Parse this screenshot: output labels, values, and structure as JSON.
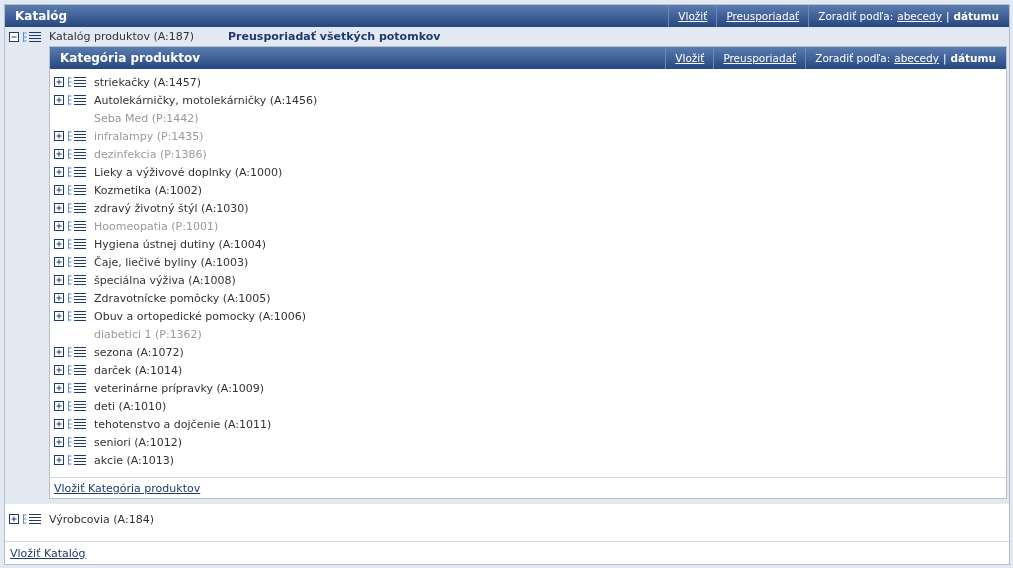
{
  "catalog": {
    "title": "Katalóg",
    "actions": [
      "Vložiť",
      "Preusporiadať"
    ],
    "sort_label": "Zoradiť podľa:",
    "sort_options": [
      {
        "label": "abecedy",
        "selected": false
      },
      {
        "label": "dátumu",
        "selected": true
      }
    ],
    "sort_separator": "|",
    "nodes": [
      {
        "label": "Katalóg produktov (A:187)",
        "expanded": true,
        "action": "Preusporiadať všetkých potomkov",
        "panel": {
          "title": "Kategória produktov",
          "actions": [
            "Vložiť",
            "Preusporiadať"
          ],
          "sort_label": "Zoradiť podľa:",
          "sort_options": [
            {
              "label": "abecedy",
              "selected": false
            },
            {
              "label": "dátumu",
              "selected": true
            }
          ],
          "sort_separator": "|",
          "children": [
            {
              "label": "striekačky (A:1457)",
              "expandable": true,
              "disabled": false
            },
            {
              "label": "Autolekárničky, motolekárničky (A:1456)",
              "expandable": true,
              "disabled": false
            },
            {
              "label": "Seba Med (P:1442)",
              "expandable": false,
              "disabled": true
            },
            {
              "label": "infralampy (P:1435)",
              "expandable": true,
              "disabled": true
            },
            {
              "label": "dezinfekcia (P:1386)",
              "expandable": true,
              "disabled": true
            },
            {
              "label": "Lieky a výživové doplnky (A:1000)",
              "expandable": true,
              "disabled": false
            },
            {
              "label": "Kozmetika (A:1002)",
              "expandable": true,
              "disabled": false
            },
            {
              "label": "zdravý životný štýl (A:1030)",
              "expandable": true,
              "disabled": false
            },
            {
              "label": "Hoomeopatia (P:1001)",
              "expandable": true,
              "disabled": true
            },
            {
              "label": "Hygiena ústnej dutiny (A:1004)",
              "expandable": true,
              "disabled": false
            },
            {
              "label": "Čaje, liečivé byliny (A:1003)",
              "expandable": true,
              "disabled": false
            },
            {
              "label": "špeciálna výživa (A:1008)",
              "expandable": true,
              "disabled": false
            },
            {
              "label": "Zdravotnícke pomôcky (A:1005)",
              "expandable": true,
              "disabled": false
            },
            {
              "label": "Obuv a ortopedické pomocky (A:1006)",
              "expandable": true,
              "disabled": false
            },
            {
              "label": "diabetici 1 (P:1362)",
              "expandable": false,
              "disabled": true
            },
            {
              "label": "sezona (A:1072)",
              "expandable": true,
              "disabled": false
            },
            {
              "label": "darček (A:1014)",
              "expandable": true,
              "disabled": false
            },
            {
              "label": "veterinárne prípravky (A:1009)",
              "expandable": true,
              "disabled": false
            },
            {
              "label": "deti (A:1010)",
              "expandable": true,
              "disabled": false
            },
            {
              "label": "tehotenstvo a dojčenie (A:1011)",
              "expandable": true,
              "disabled": false
            },
            {
              "label": "seniori (A:1012)",
              "expandable": true,
              "disabled": false
            },
            {
              "label": "akcie (A:1013)",
              "expandable": true,
              "disabled": false
            }
          ],
          "add_link": "Vložiť Kategória produktov"
        }
      },
      {
        "label": "Výrobcovia (A:184)",
        "expanded": false
      }
    ],
    "add_link": "Vložiť Katalóg"
  }
}
